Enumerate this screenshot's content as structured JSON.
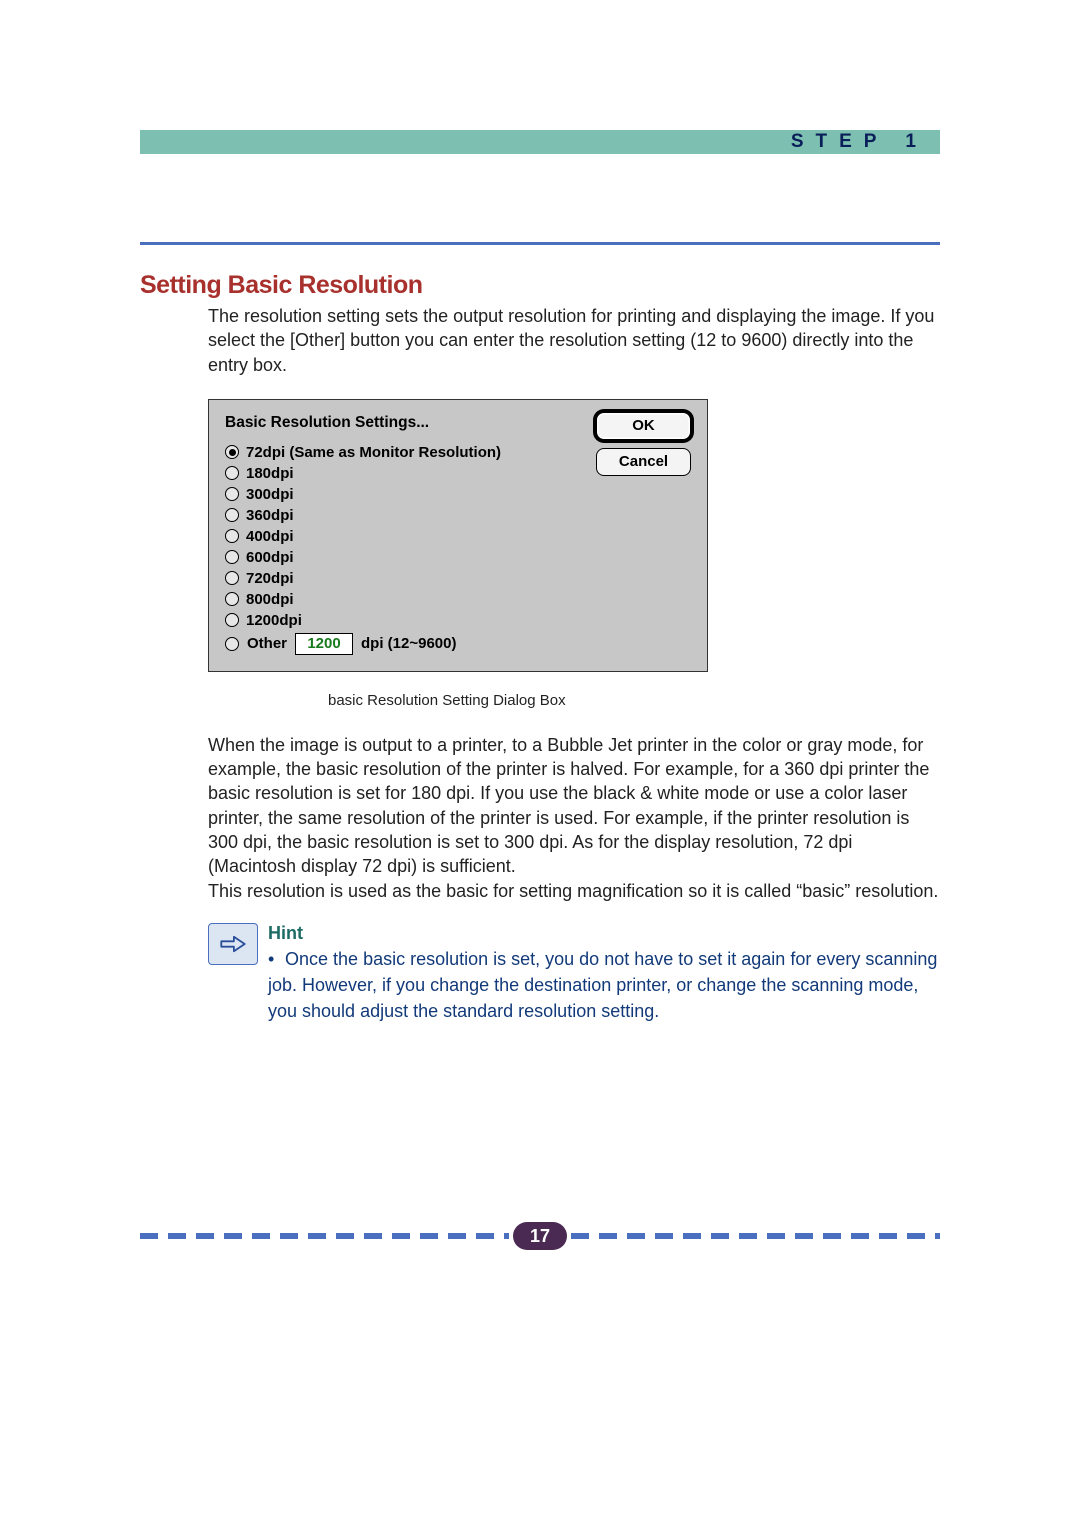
{
  "header": {
    "step_label": "STEP 1"
  },
  "section": {
    "title": "Setting Basic Resolution",
    "intro": "The resolution setting sets the output resolution for printing and displaying the image. If you select the [Other] button you can enter the resolution setting (12 to 9600) directly into the entry box."
  },
  "dialog": {
    "title": "Basic Resolution Settings...",
    "ok_label": "OK",
    "cancel_label": "Cancel",
    "options": [
      {
        "label": "72dpi (Same as Monitor Resolution)",
        "selected": true
      },
      {
        "label": "180dpi",
        "selected": false
      },
      {
        "label": "300dpi",
        "selected": false
      },
      {
        "label": "360dpi",
        "selected": false
      },
      {
        "label": "400dpi",
        "selected": false
      },
      {
        "label": "600dpi",
        "selected": false
      },
      {
        "label": "720dpi",
        "selected": false
      },
      {
        "label": "800dpi",
        "selected": false
      },
      {
        "label": "1200dpi",
        "selected": false
      }
    ],
    "other": {
      "label": "Other",
      "value": "1200",
      "suffix": "dpi  (12~9600)"
    }
  },
  "caption": "basic Resolution Setting Dialog Box",
  "body2": "When the image is output to a printer, to a Bubble Jet printer in the color or gray mode, for example, the basic resolution of the printer is halved. For example, for a 360 dpi printer the basic resolution is set for 180 dpi. If you use the black & white mode or use a color laser printer, the same resolution of the printer is used. For example, if the printer resolution is 300 dpi, the basic resolution is set to 300 dpi. As for the display resolution, 72 dpi (Macintosh display 72 dpi) is sufficient.\nThis resolution is used as the basic for setting magnification so it is called “basic” resolution.",
  "hint": {
    "label": "Hint",
    "text": "Once the basic resolution is set, you do not have to set it again for every scanning job.  However, if you change the destination printer, or change the scanning mode, you should adjust the standard resolution setting."
  },
  "page_number": "17"
}
